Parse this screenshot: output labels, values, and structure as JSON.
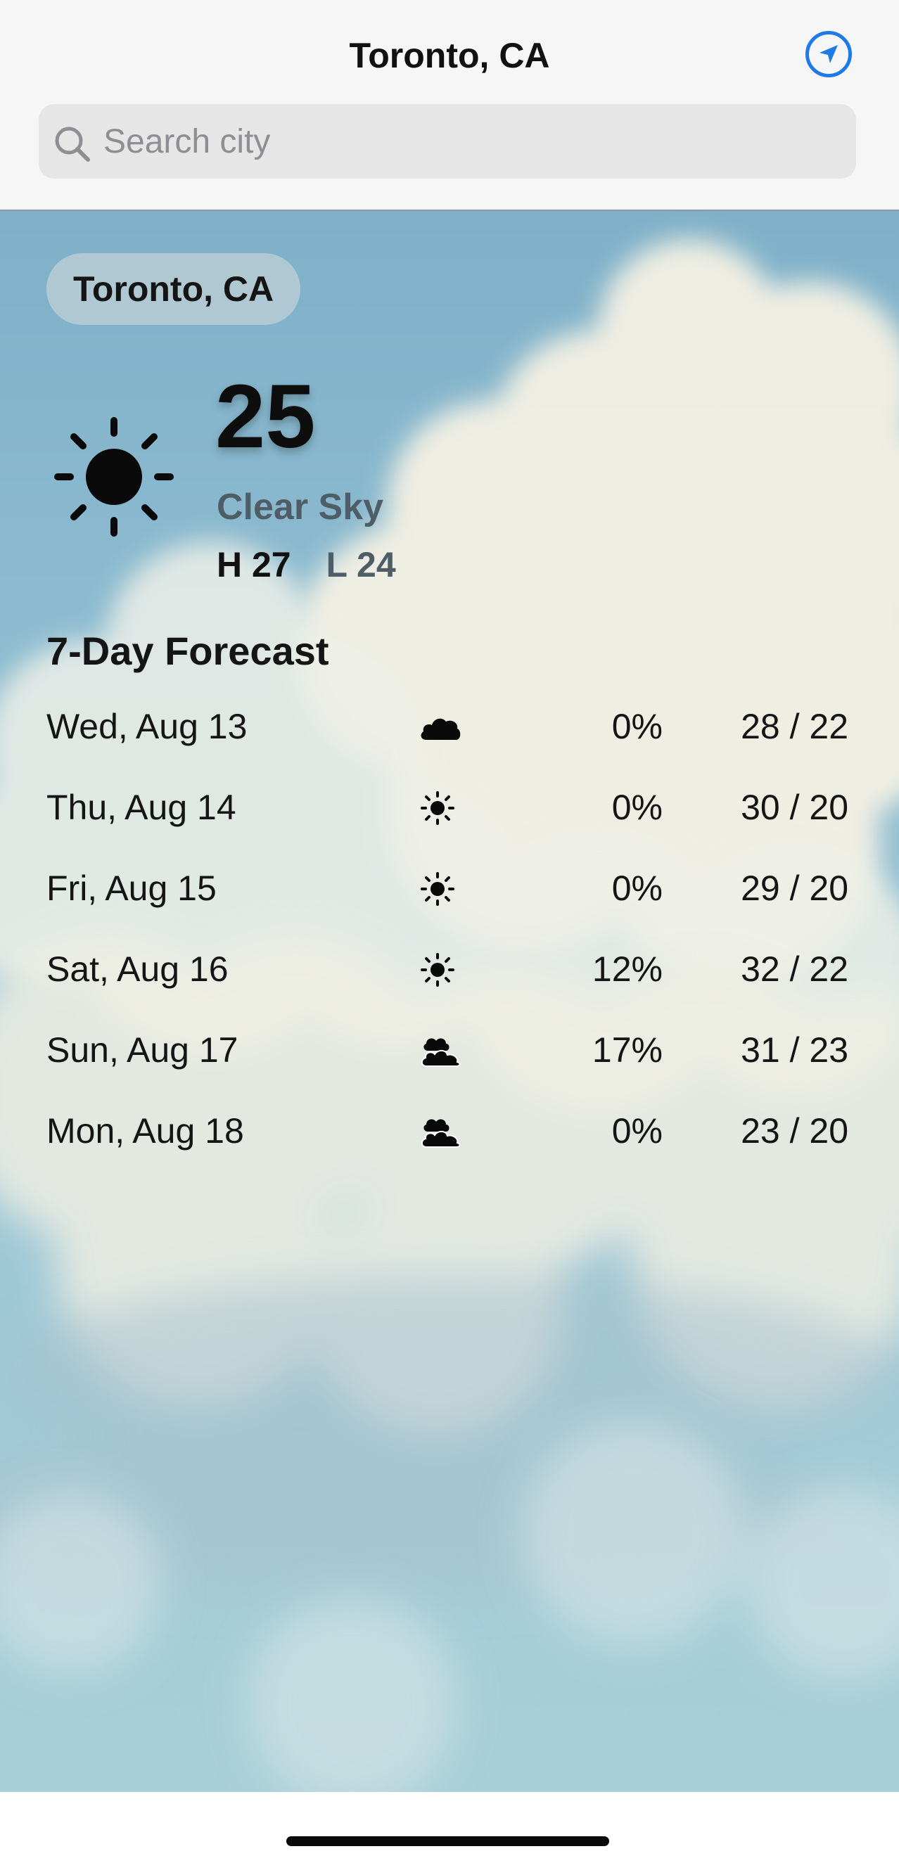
{
  "header": {
    "title": "Toronto, CA",
    "locate_icon": "location-arrow-icon",
    "search": {
      "placeholder": "Search city",
      "value": ""
    }
  },
  "current": {
    "location_chip": "Toronto, CA",
    "icon": "sun-icon",
    "temperature": "25",
    "condition": "Clear Sky",
    "high": "H 27",
    "low": "L 24"
  },
  "forecast": {
    "title": "7-Day Forecast",
    "days": [
      {
        "day": "Wed, Aug 13",
        "icon": "cloud-icon",
        "precip": "0%",
        "temps": "28 / 22"
      },
      {
        "day": "Thu, Aug 14",
        "icon": "sun-icon",
        "precip": "0%",
        "temps": "30 / 20"
      },
      {
        "day": "Fri, Aug 15",
        "icon": "sun-icon",
        "precip": "0%",
        "temps": "29 / 20"
      },
      {
        "day": "Sat, Aug 16",
        "icon": "sun-icon",
        "precip": "12%",
        "temps": "32 / 22"
      },
      {
        "day": "Sun, Aug 17",
        "icon": "clouds-icon",
        "precip": "17%",
        "temps": "31 / 23"
      },
      {
        "day": "Mon, Aug 18",
        "icon": "clouds-icon",
        "precip": "0%",
        "temps": "23 / 20"
      }
    ]
  },
  "colors": {
    "accent": "#1e7ae6",
    "header_bg": "#f6f6f6",
    "search_bg": "#e6e6e6",
    "sky": "#8fbdd1",
    "secondary_text": "#4f5e66"
  }
}
